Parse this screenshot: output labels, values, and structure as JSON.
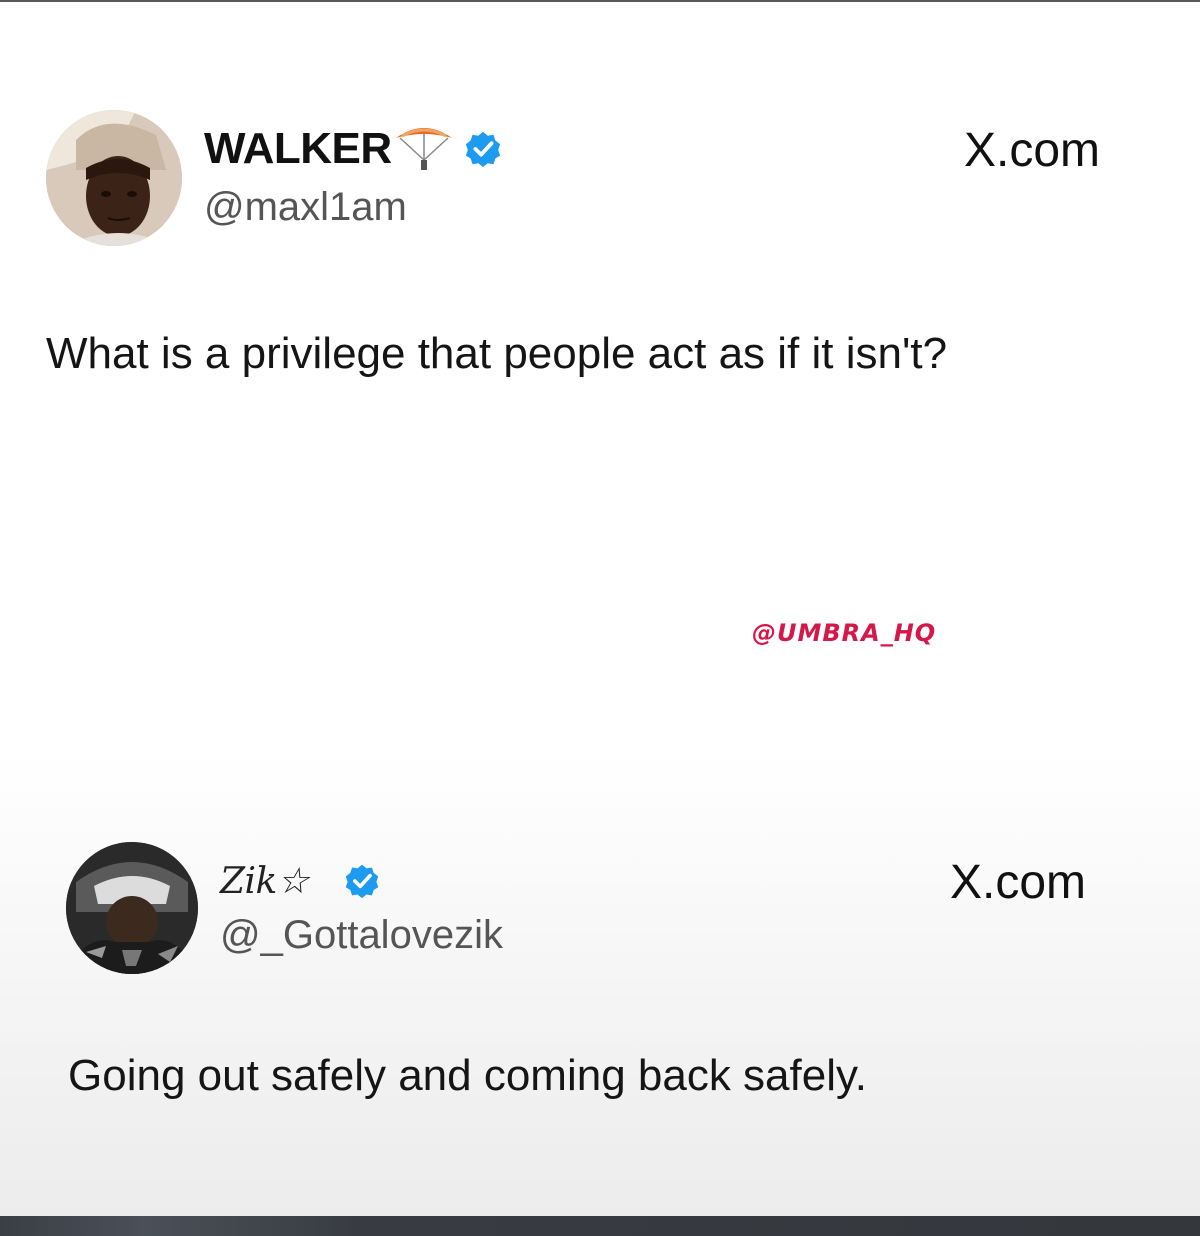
{
  "tweets": [
    {
      "author_name": "WALKER",
      "handle": "@maxl1am",
      "site": "X.com",
      "text": "What is a privilege that people act as if it isn't?",
      "verified": true,
      "name_emoji": "paraglider-icon"
    },
    {
      "author_name": "Zik☆",
      "handle": "@_Gottalovezik",
      "site": "X.com",
      "text": "Going out safely and coming back safely.",
      "verified": true
    }
  ],
  "watermark": "@UMBRA_HQ",
  "colors": {
    "verified_badge": "#1d9bf0",
    "watermark": "#d6174a",
    "bottom_bar": "#3a3f46"
  }
}
